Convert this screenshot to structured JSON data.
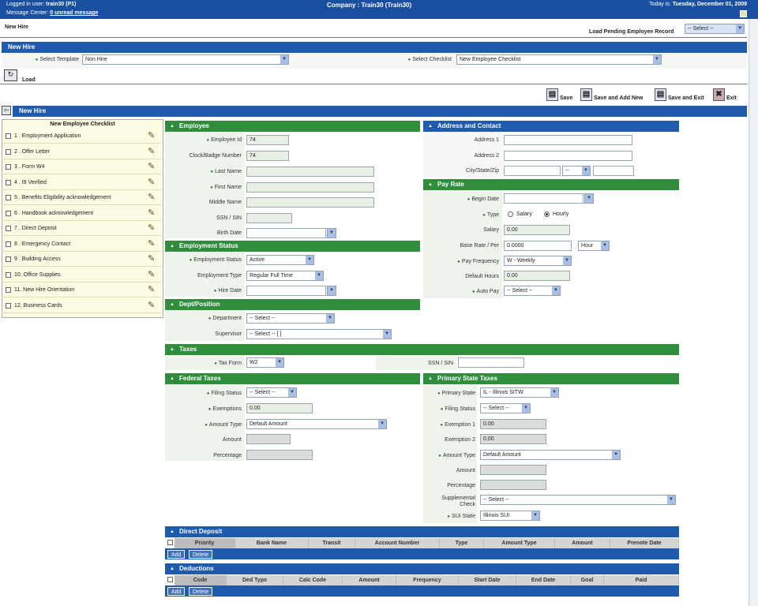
{
  "topbar": {
    "logged_in_label": "Logged in user:",
    "logged_in_user": "train30 (P1)",
    "message_center_label": "Message Center:",
    "unread": "0 unread message",
    "company": "Company : Train30 (Train30)",
    "today_label": "Today is:",
    "today": "Tuesday, December 01, 2009"
  },
  "page": {
    "title": "New Hire",
    "load_pending_label": "Load Pending Employee Record",
    "load_pending_value": "-- Select --"
  },
  "template_bar": {
    "title": "New Hire",
    "select_template_label": "Select Template",
    "template_value": "Non Hire",
    "select_checklist_label": "Select Checklist",
    "checklist_value": "New Employee Checklist",
    "load_label": "Load"
  },
  "toolbar": {
    "save": "Save",
    "save_add": "Save and Add New",
    "save_exit": "Save and Exit",
    "exit": "Exit"
  },
  "section": {
    "title": "New Hire"
  },
  "checklist": {
    "title": "New Employee Checklist",
    "items": [
      "1 . Employment Application",
      "2 . Offer Letter",
      "3 . Form W4",
      "4 . I9 Verified",
      "5 . Benefits Eligibility acknowledgement",
      "6 . Handbook acknowledgement",
      "7 . Direct Deposit",
      "8 . Emergency Contact",
      "9 . Building Access",
      "10. Office Supplies",
      "11. New Hire Orientation",
      "12. Business Cards"
    ]
  },
  "employee": {
    "title": "Employee",
    "employee_id_label": "Employee Id",
    "employee_id": "74",
    "clock_label": "Clock/Badge Number",
    "clock": "74",
    "last_name_label": "Last Name",
    "first_name_label": "First Name",
    "middle_name_label": "Middle Name",
    "ssn_label": "SSN / SIN",
    "birth_date_label": "Birth Date"
  },
  "employment_status": {
    "title": "Employment Status",
    "status_label": "Employment Status",
    "status": "Active",
    "type_label": "Employment Type",
    "type": "Regular Full Time",
    "hire_date_label": "Hire Date"
  },
  "dept": {
    "title": "Dept/Position",
    "department_label": "Department",
    "department": "-- Select --",
    "supervisor_label": "Supervisor",
    "supervisor": "-- Select -- [ ]"
  },
  "address": {
    "title": "Address and Contact",
    "address1_label": "Address 1",
    "address2_label": "Address 2",
    "city_label": "City/State/Zip",
    "state": "--"
  },
  "pay_rate": {
    "title": "Pay Rate",
    "begin_date_label": "Begin Date",
    "type_label": "Type",
    "salary_option": "Salary",
    "hourly_option": "Hourly",
    "salary_label": "Salary",
    "salary": "0.00",
    "base_rate_label": "Base Rate / Per",
    "base_rate": "0.0000",
    "per": "Hour",
    "frequency_label": "Pay Frequency",
    "frequency": "W - Weekly",
    "default_hours_label": "Default Hours",
    "default_hours": "0.00",
    "auto_pay_label": "Auto Pay",
    "auto_pay": "-- Select --"
  },
  "taxes": {
    "title": "Taxes",
    "tax_form_label": "Tax Form",
    "tax_form": "W2",
    "ssn_label": "SSN / SIN"
  },
  "federal": {
    "title": "Federal Taxes",
    "filing_label": "Filing Status",
    "filing": "-- Select --",
    "exemptions_label": "Exemptions",
    "exemptions": "0.00",
    "amount_type_label": "Amount Type",
    "amount_type": "Default Amount",
    "amount_label": "Amount",
    "percentage_label": "Percentage"
  },
  "state": {
    "title": "Primary State Taxes",
    "primary_state_label": "Primary State",
    "primary_state": "IL - Illinois SITW",
    "filing_label": "Filing Status",
    "filing": "-- Select --",
    "ex1_label": "Exemption 1",
    "ex1": "0.00",
    "ex2_label": "Exemption 2",
    "ex2": "0.00",
    "amount_type_label": "Amount Type",
    "amount_type": "Default Amount",
    "amount_label": "Amount",
    "percentage_label": "Percentage",
    "supplemental_label": "Supplemental Check",
    "supplemental": "-- Select --",
    "sui_label": "SUI State",
    "sui": "Illinois SUI"
  },
  "direct_deposit": {
    "title": "Direct Deposit",
    "columns": [
      "Priority",
      "Bank Name",
      "Transit",
      "Account Number",
      "Type",
      "Amount Type",
      "Amount",
      "Prenote Date"
    ],
    "add": "Add",
    "delete": "Delete"
  },
  "deductions": {
    "title": "Deductions",
    "columns": [
      "Code",
      "Ded Type",
      "Calc Code",
      "Amount",
      "Frequency",
      "Start Date",
      "End Date",
      "Goal",
      "Paid"
    ],
    "add": "Add",
    "delete": "Delete"
  }
}
